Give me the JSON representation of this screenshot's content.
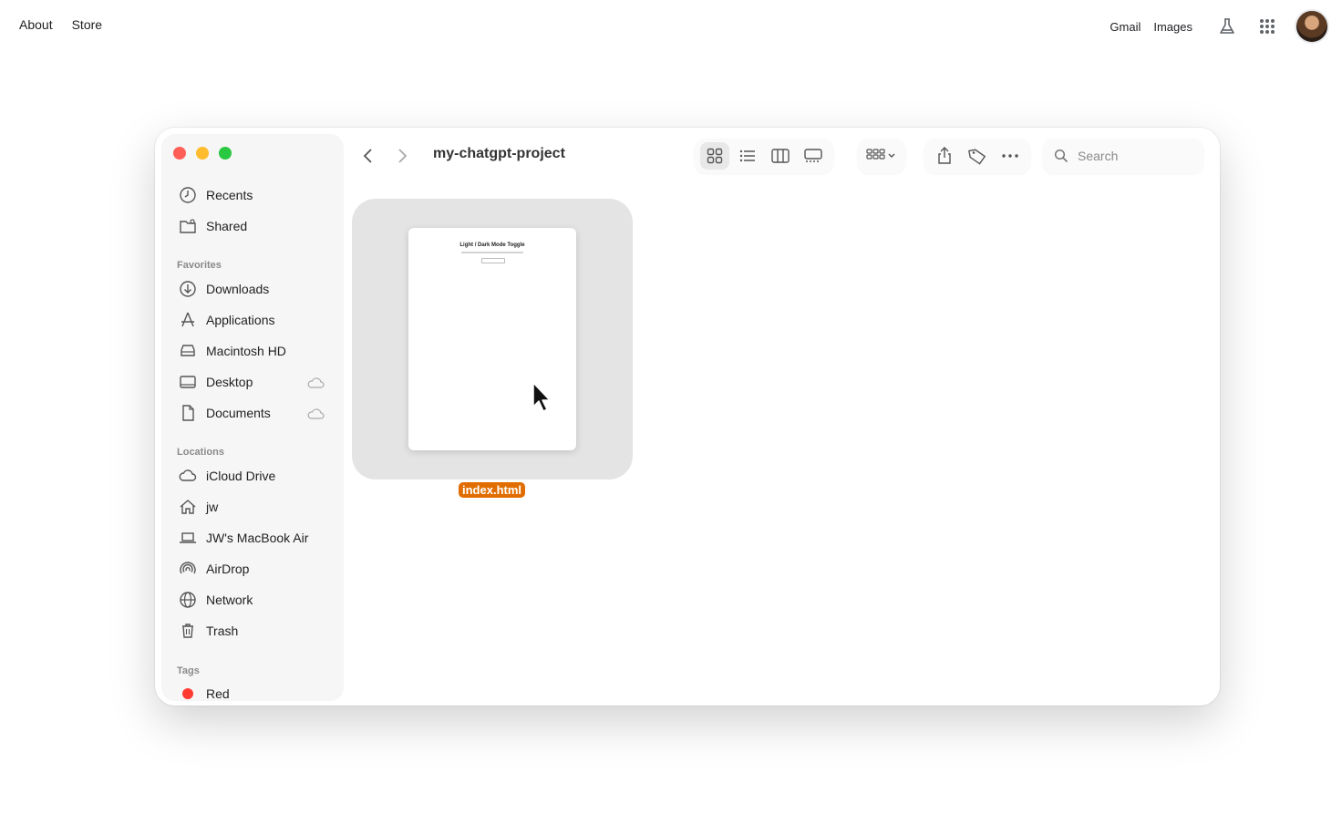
{
  "topnav": {
    "about": "About",
    "store": "Store",
    "gmail": "Gmail",
    "images": "Images",
    "icons": [
      "labs-flask-icon",
      "apps-grid-icon",
      "avatar"
    ]
  },
  "window": {
    "title": "my-chatgpt-project",
    "search_placeholder": "Search"
  },
  "sidebar": {
    "top_items": [
      {
        "label": "Recents",
        "icon": "clock-icon"
      },
      {
        "label": "Shared",
        "icon": "shared-folder-icon"
      }
    ],
    "favorites_header": "Favorites",
    "favorites": [
      {
        "label": "Downloads",
        "icon": "download-icon"
      },
      {
        "label": "Applications",
        "icon": "applications-icon"
      },
      {
        "label": "Macintosh HD",
        "icon": "disk-icon"
      },
      {
        "label": "Desktop",
        "icon": "desktop-icon"
      },
      {
        "label": "Documents",
        "icon": "document-icon"
      }
    ],
    "locations_header": "Locations",
    "locations": [
      {
        "label": "iCloud Drive",
        "icon": "cloud-icon"
      },
      {
        "label": "jw",
        "icon": "home-icon"
      },
      {
        "label": "JW's MacBook Air",
        "icon": "laptop-icon"
      },
      {
        "label": "AirDrop",
        "icon": "airdrop-icon"
      },
      {
        "label": "Network",
        "icon": "globe-icon"
      },
      {
        "label": "Trash",
        "icon": "trash-icon"
      }
    ],
    "tags_header": "Tags",
    "tags": [
      {
        "label": "Red",
        "color": "#ff3b30"
      }
    ]
  },
  "file": {
    "name": "index.html",
    "preview_title": "Light / Dark Mode Toggle",
    "label_color": "#e16d00"
  },
  "colors": {
    "traffic_red": "#ff5f57",
    "traffic_yellow": "#febc2e",
    "traffic_green": "#28c840"
  }
}
